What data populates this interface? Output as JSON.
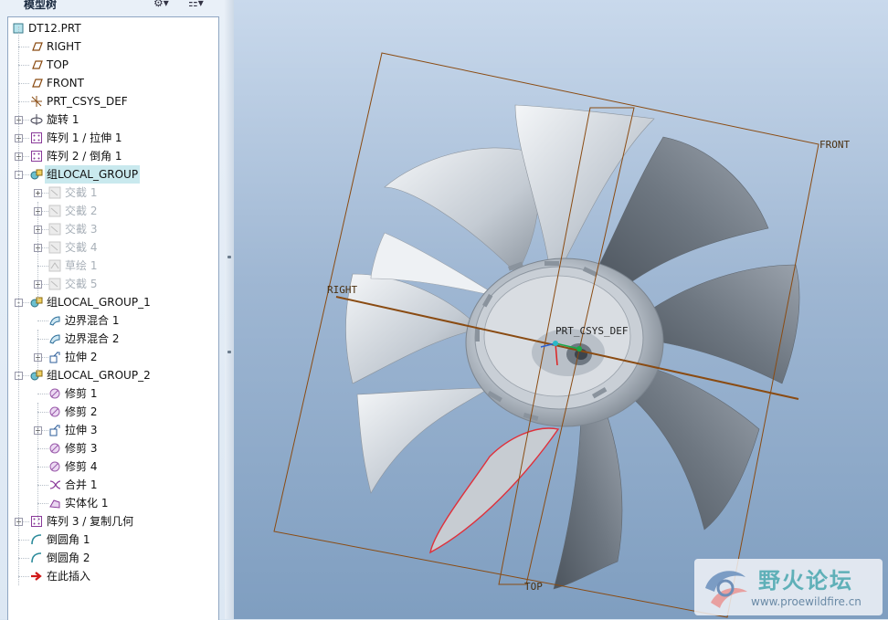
{
  "panel": {
    "title": "模型树",
    "settings_btn": "⚙▾",
    "view_btn": "☷▾"
  },
  "tree": [
    {
      "label": "DT12.PRT",
      "level": 0,
      "expander": "",
      "icon": "part-icon",
      "state": "normal"
    },
    {
      "label": "RIGHT",
      "level": 1,
      "expander": "",
      "icon": "datum-plane-icon",
      "state": "normal"
    },
    {
      "label": "TOP",
      "level": 1,
      "expander": "",
      "icon": "datum-plane-icon",
      "state": "normal"
    },
    {
      "label": "FRONT",
      "level": 1,
      "expander": "",
      "icon": "datum-plane-icon",
      "state": "normal"
    },
    {
      "label": "PRT_CSYS_DEF",
      "level": 1,
      "expander": "",
      "icon": "coordinate-system-icon",
      "state": "normal"
    },
    {
      "label": "旋转 1",
      "level": 1,
      "expander": "+",
      "icon": "revolve-icon",
      "state": "normal"
    },
    {
      "label": "阵列 1 / 拉伸 1",
      "level": 1,
      "expander": "+",
      "icon": "pattern-icon",
      "state": "normal"
    },
    {
      "label": "阵列 2 / 倒角 1",
      "level": 1,
      "expander": "+",
      "icon": "pattern-icon",
      "state": "normal"
    },
    {
      "label": "组LOCAL_GROUP",
      "level": 1,
      "expander": "-",
      "icon": "group-icon",
      "state": "selected"
    },
    {
      "label": "交截 1",
      "level": 2,
      "expander": "+",
      "icon": "intersect-icon",
      "state": "dim"
    },
    {
      "label": "交截 2",
      "level": 2,
      "expander": "+",
      "icon": "intersect-icon",
      "state": "dim"
    },
    {
      "label": "交截 3",
      "level": 2,
      "expander": "+",
      "icon": "intersect-icon",
      "state": "dim"
    },
    {
      "label": "交截 4",
      "level": 2,
      "expander": "+",
      "icon": "intersect-icon",
      "state": "dim"
    },
    {
      "label": "草绘 1",
      "level": 2,
      "expander": "",
      "icon": "sketch-icon",
      "state": "dim"
    },
    {
      "label": "交截 5",
      "level": 2,
      "expander": "+",
      "icon": "intersect-icon",
      "state": "dim"
    },
    {
      "label": "组LOCAL_GROUP_1",
      "level": 1,
      "expander": "-",
      "icon": "group-icon",
      "state": "normal"
    },
    {
      "label": "边界混合 1",
      "level": 2,
      "expander": "",
      "icon": "boundary-blend-icon",
      "state": "normal"
    },
    {
      "label": "边界混合 2",
      "level": 2,
      "expander": "",
      "icon": "boundary-blend-icon",
      "state": "normal"
    },
    {
      "label": "拉伸 2",
      "level": 2,
      "expander": "+",
      "icon": "extrude-icon",
      "state": "normal"
    },
    {
      "label": "组LOCAL_GROUP_2",
      "level": 1,
      "expander": "-",
      "icon": "group-icon",
      "state": "normal"
    },
    {
      "label": "修剪 1",
      "level": 2,
      "expander": "",
      "icon": "trim-icon",
      "state": "normal"
    },
    {
      "label": "修剪 2",
      "level": 2,
      "expander": "",
      "icon": "trim-icon",
      "state": "normal"
    },
    {
      "label": "拉伸 3",
      "level": 2,
      "expander": "+",
      "icon": "extrude-icon",
      "state": "normal"
    },
    {
      "label": "修剪 3",
      "level": 2,
      "expander": "",
      "icon": "trim-icon",
      "state": "normal"
    },
    {
      "label": "修剪 4",
      "level": 2,
      "expander": "",
      "icon": "trim-icon",
      "state": "normal"
    },
    {
      "label": "合并 1",
      "level": 2,
      "expander": "",
      "icon": "merge-icon",
      "state": "normal"
    },
    {
      "label": "实体化 1",
      "level": 2,
      "expander": "",
      "icon": "solidify-icon",
      "state": "normal"
    },
    {
      "label": "阵列 3 / 复制几何",
      "level": 1,
      "expander": "+",
      "icon": "pattern-icon",
      "state": "normal"
    },
    {
      "label": "倒圆角 1",
      "level": 1,
      "expander": "",
      "icon": "round-icon",
      "state": "normal"
    },
    {
      "label": "倒圆角 2",
      "level": 1,
      "expander": "",
      "icon": "round-icon",
      "state": "normal"
    },
    {
      "label": "在此插入",
      "level": 1,
      "expander": "",
      "icon": "insert-here-arrow-icon",
      "state": "normal"
    }
  ],
  "viewport": {
    "datum_labels": {
      "front": "FRONT",
      "right": "RIGHT",
      "top": "TOP",
      "csys": "PRT_CSYS_DEF"
    }
  },
  "watermark": {
    "text": "野火论坛",
    "url": "www.proewildfire.cn"
  },
  "colors": {
    "datum": "#8a4b12",
    "highlight": "#e0303a",
    "selection": "#c9e9ee",
    "background": "#9fb7d3"
  }
}
